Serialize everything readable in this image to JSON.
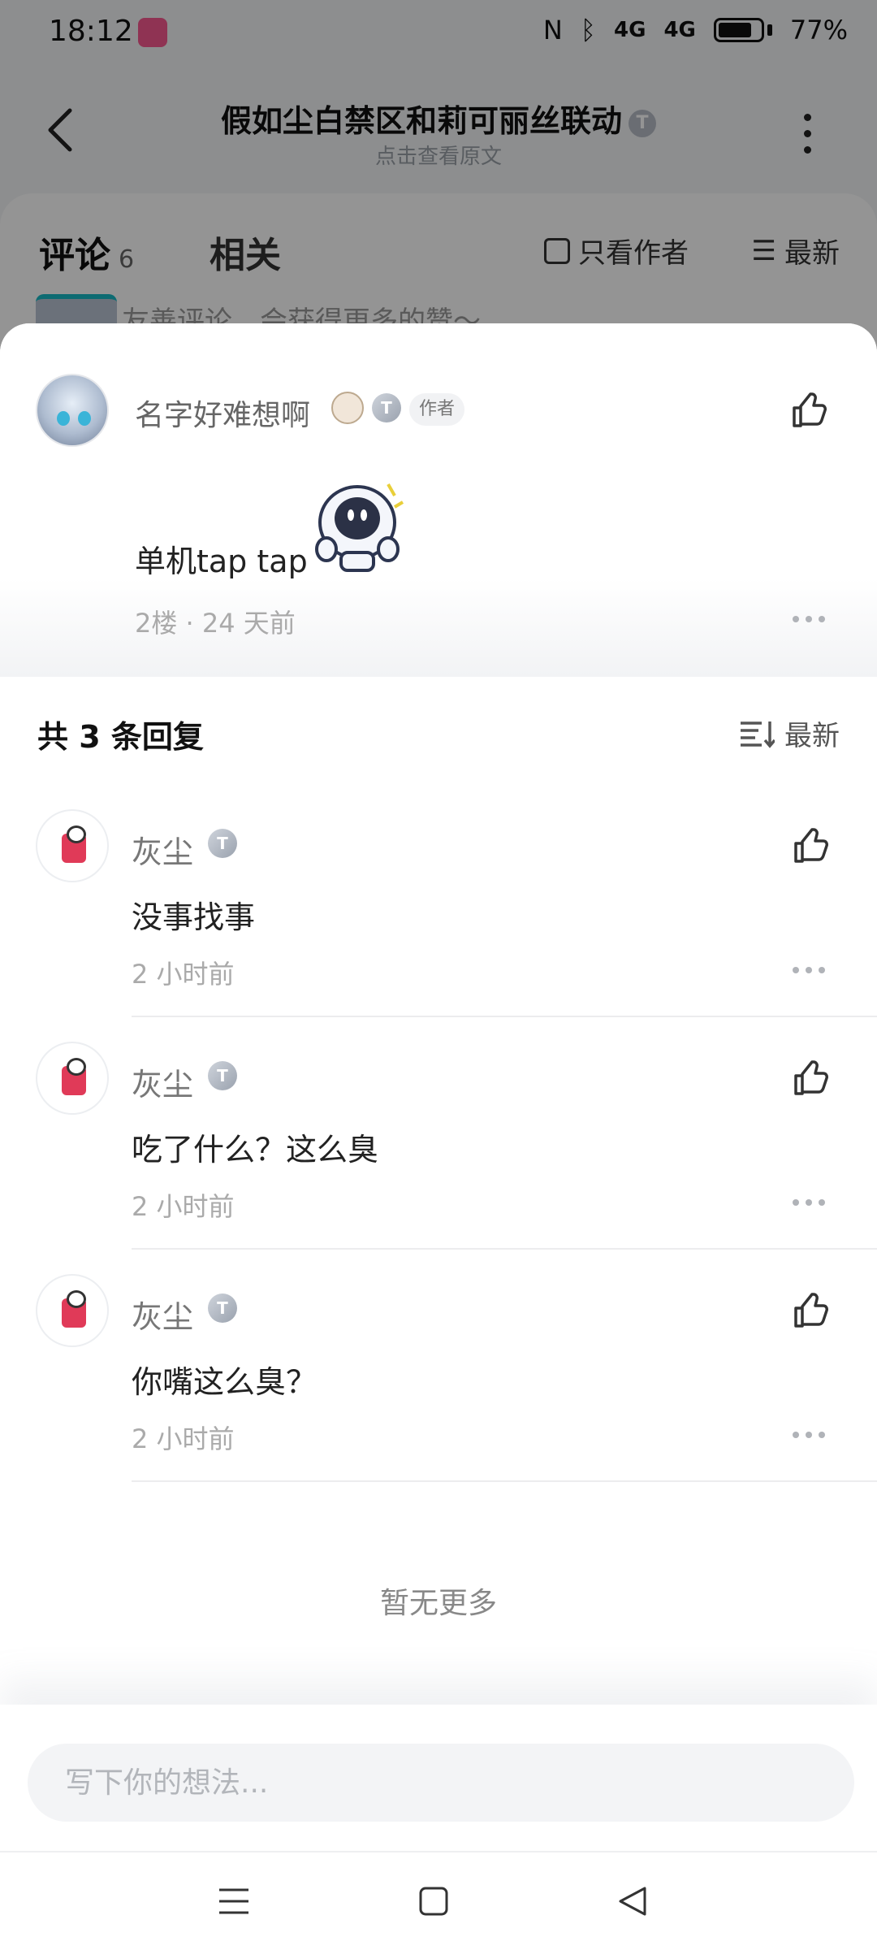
{
  "status_bar": {
    "time": "18:12",
    "battery": "77%",
    "network": "4G"
  },
  "header": {
    "title": "假如尘白禁区和莉可丽丝联动",
    "title_badge": "T",
    "subtitle": "点击查看原文"
  },
  "background_tabs": {
    "comments_label": "评论",
    "comments_count": "6",
    "related_label": "相关",
    "author_only_label": "只看作者",
    "sort_label": "最新",
    "input_hint": "友善评论，会获得更多的赞～"
  },
  "parent_comment": {
    "author": "名字好难想啊",
    "level": "T",
    "author_tag": "作者",
    "body": "单机tap tap",
    "floor": "2楼",
    "separator": "·",
    "time": "24 天前"
  },
  "replies_section": {
    "count_label": "共 3 条回复",
    "sort_label": "最新",
    "items": [
      {
        "author": "灰尘",
        "level": "T",
        "text": "没事找事",
        "time": "2 小时前"
      },
      {
        "author": "灰尘",
        "level": "T",
        "text": "吃了什么？这么臭",
        "time": "2 小时前"
      },
      {
        "author": "灰尘",
        "level": "T",
        "text": "你嘴这么臭？",
        "time": "2 小时前"
      }
    ],
    "no_more": "暂无更多"
  },
  "composer": {
    "placeholder": "写下你的想法..."
  },
  "colors": {
    "accent_pink": "#f6598f",
    "muted_text": "#aaaaaa",
    "input_bg": "#f3f4f6"
  }
}
